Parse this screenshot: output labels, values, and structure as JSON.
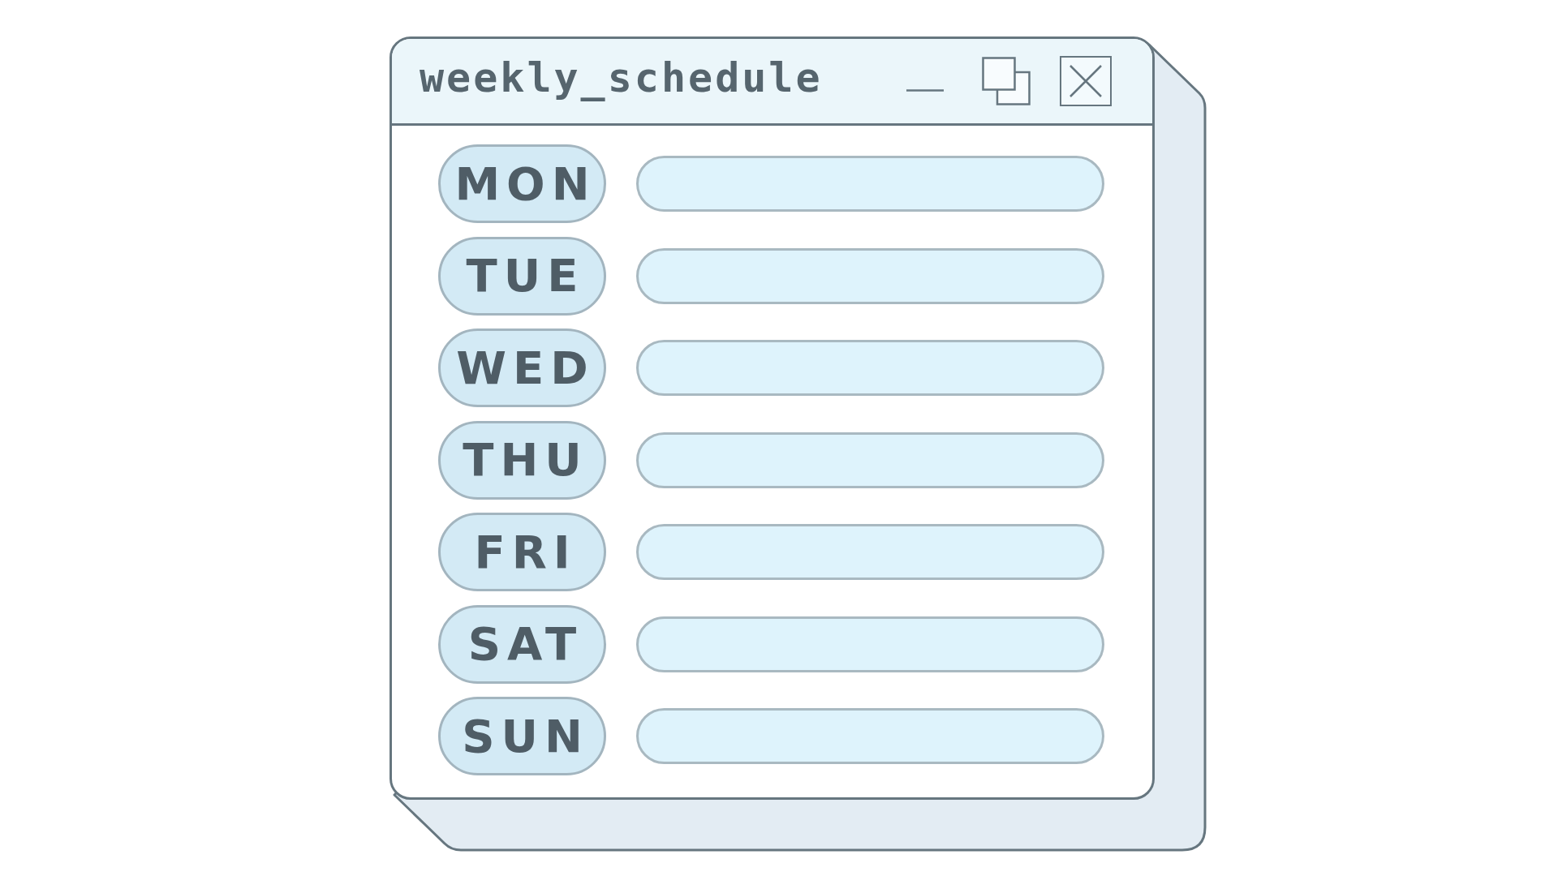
{
  "window": {
    "title": "weekly_schedule"
  },
  "days": [
    {
      "label": "MON"
    },
    {
      "label": "TUE"
    },
    {
      "label": "WED"
    },
    {
      "label": "THU"
    },
    {
      "label": "FRI"
    },
    {
      "label": "SAT"
    },
    {
      "label": "SUN"
    }
  ]
}
